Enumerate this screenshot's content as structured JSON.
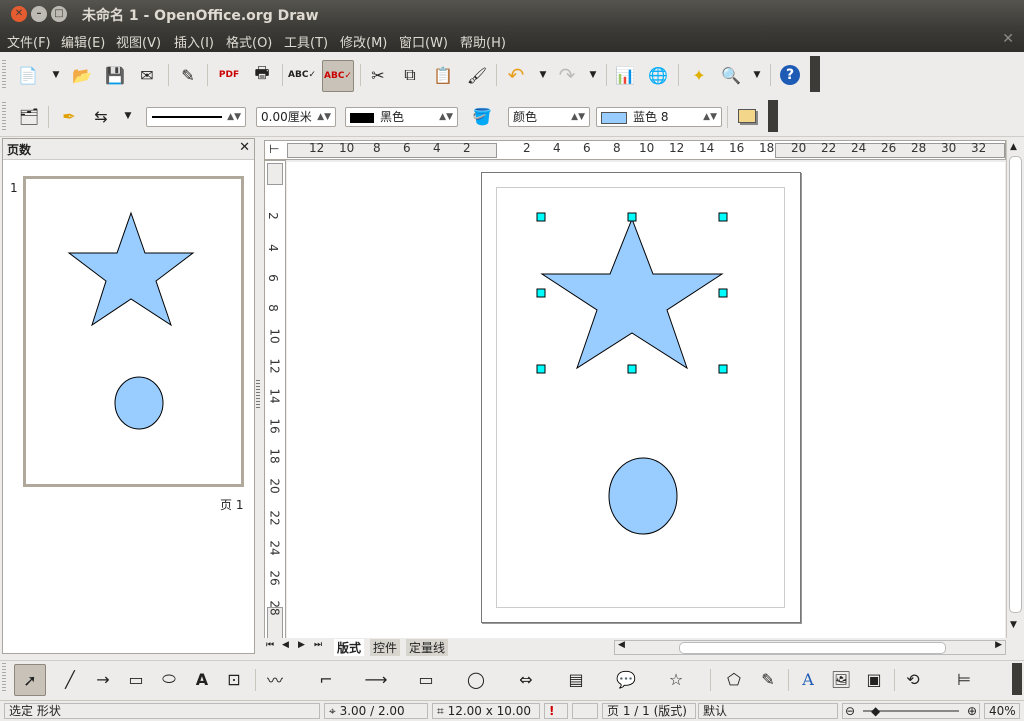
{
  "window": {
    "title": "未命名 1 - OpenOffice.org Draw"
  },
  "menu": [
    "文件(F)",
    "编辑(E)",
    "视图(V)",
    "插入(I)",
    "格式(O)",
    "工具(T)",
    "修改(M)",
    "窗口(W)",
    "帮助(H)"
  ],
  "line_toolbar": {
    "line_width": "0.00厘米",
    "line_color": "黑色",
    "fill_type": "颜色",
    "fill_color": "蓝色 8"
  },
  "colors": {
    "shape_fill": "#99ccff",
    "line_color_swatch": "#000000",
    "fill_color_swatch": "#99ccff",
    "handle": "#00ffff"
  },
  "sidebar": {
    "title": "页数",
    "slide_number": "1",
    "slide_label": "页 1"
  },
  "ruler": {
    "horizontal_ticks": [
      "12",
      "10",
      "8",
      "6",
      "4",
      "2",
      "2",
      "4",
      "6",
      "8",
      "10",
      "12",
      "14",
      "16",
      "18",
      "20",
      "22",
      "24",
      "26",
      "28",
      "30",
      "32"
    ],
    "vertical_ticks": [
      "2",
      "4",
      "6",
      "8",
      "10",
      "12",
      "14",
      "16",
      "18",
      "20",
      "22",
      "24",
      "26",
      "28"
    ]
  },
  "tabs": [
    "版式",
    "控件",
    "定量线"
  ],
  "status": {
    "selection": "选定 形状",
    "position": "3.00 / 2.00",
    "size": "12.00 x 10.00",
    "page": "页 1 / 1 (版式)",
    "style": "默认",
    "zoom": "40%"
  }
}
